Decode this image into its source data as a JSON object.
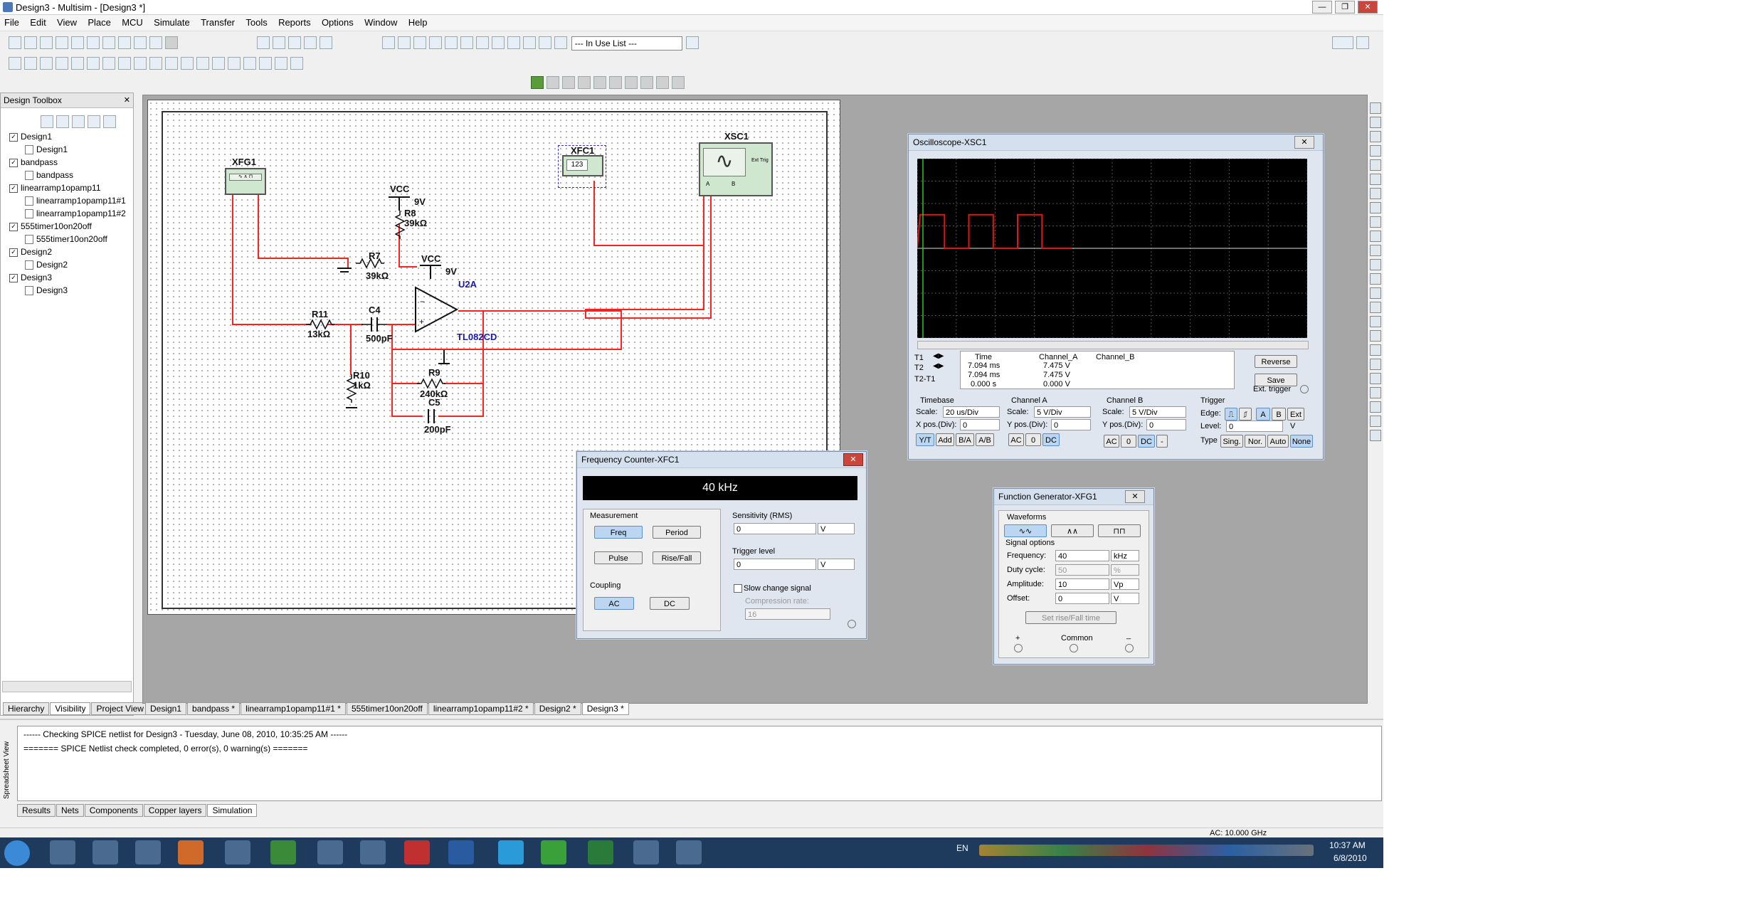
{
  "title": "Design3 - Multisim - [Design3 *]",
  "menu": [
    "File",
    "Edit",
    "View",
    "Place",
    "MCU",
    "Simulate",
    "Transfer",
    "Tools",
    "Reports",
    "Options",
    "Window",
    "Help"
  ],
  "toolbar": {
    "in_use_list": "--- In Use List ---"
  },
  "toolbox": {
    "title": "Design Toolbox",
    "items": [
      "Design1",
      "Design1",
      "bandpass",
      "bandpass",
      "linearramp1opamp11",
      "linearramp1opamp11#1",
      "linearramp1opamp11#2",
      "555timer10on20off",
      "555timer10on20off",
      "Design2",
      "Design2",
      "Design3",
      "Design3"
    ],
    "tabs": [
      "Hierarchy",
      "Visibility",
      "Project View"
    ]
  },
  "schematic": {
    "xfg1": "XFG1",
    "xfc1": "XFC1",
    "xfc1_display": "123",
    "xsc1": "XSC1",
    "vcc1": "VCC",
    "v1": "9V",
    "r8": "R8",
    "r8v": "39kΩ",
    "r7": "R7",
    "r7v": "39kΩ",
    "vcc2": "VCC",
    "v2": "9V",
    "u2a": "U2A",
    "tl082": "TL082CD",
    "r11": "R11",
    "r11v": "13kΩ",
    "c4": "C4",
    "c4v": "500pF",
    "r10": "R10",
    "r10v": "1kΩ",
    "r9": "R9",
    "r9v": "240kΩ",
    "c5": "C5",
    "c5v": "200pF",
    "ext_trig": "Ext Trig",
    "chA": "A",
    "chB": "B"
  },
  "doc_tabs": [
    "Design1",
    "bandpass *",
    "linearramp1opamp11#1 *",
    "555timer10on20off",
    "linearramp1opamp11#2 *",
    "Design2 *",
    "Design3 *"
  ],
  "oscilloscope": {
    "title": "Oscilloscope-XSC1",
    "table_headers": [
      "Time",
      "Channel_A",
      "Channel_B"
    ],
    "rows": [
      {
        "label": "T1",
        "time": "7.094 ms",
        "a": "7.475 V",
        "b": ""
      },
      {
        "label": "T2",
        "time": "7.094 ms",
        "a": "7.475 V",
        "b": ""
      },
      {
        "label": "T2-T1",
        "time": "0.000 s",
        "a": "0.000 V",
        "b": ""
      }
    ],
    "reverse": "Reverse",
    "save": "Save",
    "ext_trigger": "Ext. trigger",
    "timebase": {
      "title": "Timebase",
      "scale_label": "Scale:",
      "scale": "20 us/Div",
      "xpos_label": "X pos.(Div):",
      "xpos": "0",
      "modes": [
        "Y/T",
        "Add",
        "B/A",
        "A/B"
      ]
    },
    "chA": {
      "title": "Channel A",
      "scale_label": "Scale:",
      "scale": "5  V/Div",
      "ypos_label": "Y pos.(Div):",
      "ypos": "0",
      "cpl": [
        "AC",
        "0",
        "DC"
      ]
    },
    "chB": {
      "title": "Channel B",
      "scale_label": "Scale:",
      "scale": "5  V/Div",
      "ypos_label": "Y pos.(Div):",
      "ypos": "0",
      "cpl": [
        "AC",
        "0",
        "DC",
        "-"
      ]
    },
    "trigger": {
      "title": "Trigger",
      "edge_label": "Edge:",
      "level_label": "Level:",
      "level": "0",
      "level_unit": "V",
      "type_label": "Type",
      "types": [
        "Sing.",
        "Nor.",
        "Auto",
        "None"
      ],
      "edge_btns": [
        "A",
        "B",
        "Ext"
      ]
    }
  },
  "freq_counter": {
    "title": "Frequency Counter-XFC1",
    "display": "40 kHz",
    "measurement": "Measurement",
    "freq": "Freq",
    "period": "Period",
    "pulse": "Pulse",
    "risefall": "Rise/Fall",
    "coupling": "Coupling",
    "ac": "AC",
    "dc": "DC",
    "sensitivity": "Sensitivity (RMS)",
    "sens_val": "0",
    "sens_unit": "V",
    "trigger_level": "Trigger level",
    "trig_val": "0",
    "trig_unit": "V",
    "slow_change": "Slow change signal",
    "compression": "Compression rate:",
    "comp_val": "16"
  },
  "func_gen": {
    "title": "Function Generator-XFG1",
    "waveforms": "Waveforms",
    "signal_options": "Signal options",
    "fields": [
      {
        "label": "Frequency:",
        "value": "40",
        "unit": "kHz"
      },
      {
        "label": "Duty cycle:",
        "value": "50",
        "unit": "%"
      },
      {
        "label": "Amplitude:",
        "value": "10",
        "unit": "Vp"
      },
      {
        "label": "Offset:",
        "value": "0",
        "unit": "V"
      }
    ],
    "set_rise": "Set rise/Fall time",
    "plus": "+",
    "common": "Common",
    "minus": "_"
  },
  "output": {
    "line1": "------ Checking SPICE netlist for Design3 - Tuesday, June 08, 2010, 10:35:25 AM ------",
    "line2": "======= SPICE Netlist check completed, 0 error(s), 0 warning(s) =======",
    "tabs": [
      "Results",
      "Nets",
      "Components",
      "Copper layers",
      "Simulation"
    ],
    "side_label": "Spreadsheet View"
  },
  "status": {
    "ac": "AC: 10.000 GHz"
  },
  "taskbar": {
    "lang": "EN",
    "time": "10:37 AM",
    "date": "6/8/2010"
  },
  "scope_trace": {
    "wave_frequency_khz": 40,
    "high_v": 7.5,
    "low_v": 0
  }
}
